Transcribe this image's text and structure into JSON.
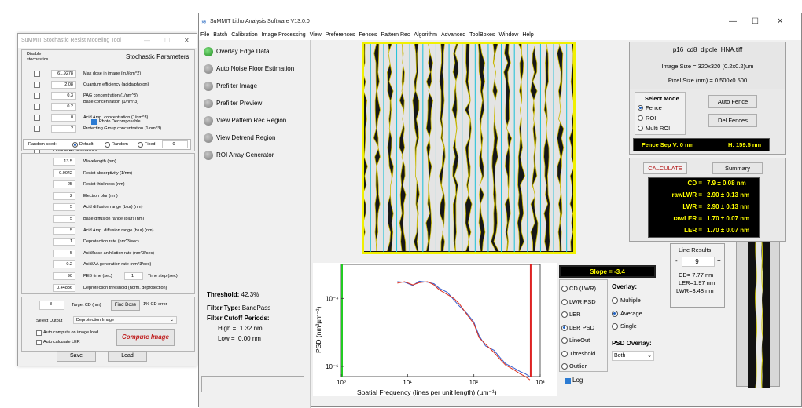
{
  "stoch": {
    "title": "SuMMIT Stochastic Resist Modeling Tool",
    "disable_label": "Disable\nstochastics",
    "params_title": "Stochastic Parameters",
    "stoch_rows": [
      {
        "value": "61.9278",
        "label": "Max dose in image (mJ/cm^2)"
      },
      {
        "value": "2.08",
        "label": "Quantum efficiency (acids/photon)"
      },
      {
        "value": "0.3",
        "label": "PAG concentration (1/nm^3)"
      },
      {
        "value": "0.2",
        "label": "Base concentration (1/nm^3)"
      },
      {
        "value": "0",
        "label": "Acid Amp. concentration (1/nm^3)"
      },
      {
        "value": "2",
        "label": "Protecting Group concentration (1/nm^3)"
      }
    ],
    "photo_decomposable": "Photo Decomposable",
    "disable_all": "Disable All Stochastics",
    "random_seed_label": "Random seed:",
    "seed_options": [
      "Default",
      "Random",
      "Fixed"
    ],
    "seed_value": "0",
    "params": [
      {
        "value": "13.5",
        "label": "Wavelength (nm)"
      },
      {
        "value": "0.0042",
        "label": "Resist absorptivity (1/nm)"
      },
      {
        "value": "25",
        "label": "Resist thickness (nm)"
      },
      {
        "value": "2",
        "label": "Electron blur (nm)"
      },
      {
        "value": "5",
        "label": "Acid diffusion range (blur) (nm)"
      },
      {
        "value": "5",
        "label": "Base diffusion range (blur) (nm)"
      },
      {
        "value": "5",
        "label": "Acid Amp. diffusion range (blur) (nm)"
      },
      {
        "value": "1",
        "label": "Deprotection rate (nm^3/sec)"
      },
      {
        "value": "5",
        "label": "Acid/base anihilation rate (nm^3/sec)"
      },
      {
        "value": "0.2",
        "label": "Acid/AA generation rate (nm^3/sec)"
      }
    ],
    "peb_value": "90",
    "peb_label": "PEB time (sec)",
    "timestep_value": "1",
    "timestep_label": "Time step (sec)",
    "threshold_value": "0.44836",
    "threshold_label": "Deprotection threshold (norm. deprotection)",
    "target_cd_value": "8",
    "target_cd_label": "Target CD (nm)",
    "find_dose": "Find Dose",
    "cd_error": "1% CD error",
    "select_output_label": "Select Output",
    "select_output_value": "Deprotection Image",
    "auto_compute": "Auto compute on image load",
    "auto_ler": "Auto calculate LER",
    "compute_image": "Compute Image",
    "save": "Save",
    "load": "Load"
  },
  "main": {
    "title": "SuMMIT Litho Analysis Software V13.0.0",
    "menu": [
      "File",
      "Batch",
      "Calibration",
      "Image Processing",
      "View",
      "Preferences",
      "Fences",
      "Pattern Rec",
      "Algorithm",
      "Advanced",
      "ToolBoxes",
      "Window",
      "Help"
    ],
    "commands": [
      "Overlay Edge Data",
      "Auto Noise Floor Estimation",
      "Prefilter Image",
      "Prefilter Preview",
      "View Pattern Rec Region",
      "View Detrend Region",
      "ROI Array Generator"
    ],
    "threshold_label": "Threshold:",
    "threshold_value": "42.3%",
    "filter_type_label": "Filter Type:",
    "filter_type_value": "BandPass",
    "cutoff_label": "Filter Cutoff Periods:",
    "high_label": "High =",
    "high_value": "1.32 nm",
    "low_label": "Low =",
    "low_value": "0.00 nm",
    "file_name": "p16_cd8_dipole_HNA.tiff",
    "image_size": "Image Size = 320x320 (0.2x0.2)um",
    "pixel_size": "Pixel Size (nm) = 0.500x0.500",
    "select_mode_title": "Select Mode",
    "modes": [
      "Fence",
      "ROI",
      "Multi ROI"
    ],
    "auto_fence": "Auto Fence",
    "del_fences": "Del Fences",
    "fence_sep": "Fence Sep  V:  0 nm",
    "fence_h": "H:  159.5 nm",
    "calculate": "CALCULATE",
    "summary": "Summary",
    "results": [
      {
        "label": "CD =",
        "value": "7.9 ± 0.08 nm"
      },
      {
        "label": "rawLWR =",
        "value": "2.90 ± 0.13 nm"
      },
      {
        "label": "LWR =",
        "value": "2.90 ± 0.13 nm"
      },
      {
        "label": "rawLER =",
        "value": "1.70 ± 0.07 nm"
      },
      {
        "label": "LER =",
        "value": "1.70 ± 0.07 nm"
      }
    ],
    "line_results_title": "Line Results",
    "line_minus": "-",
    "line_plus": "+",
    "line_index": "9",
    "line_cd": "CD= 7.77 nm",
    "line_ler": "LER=1.97 nm",
    "line_lwr": "LWR=3.48 nm",
    "slope": "Slope = -3.4",
    "psd_options": [
      "CD (LWR)",
      "LWR PSD",
      "LER",
      "LER PSD",
      "LineOut",
      "Threshold",
      "Outlier"
    ],
    "psd_selected": 3,
    "overlay_title": "Overlay:",
    "overlay_options": [
      "Multiple",
      "Average",
      "Single"
    ],
    "overlay_selected": 1,
    "psd_overlay_title": "PSD Overlay:",
    "psd_overlay_value": "Both",
    "log_label": "Log"
  },
  "chart_data": {
    "type": "line",
    "title": "",
    "xlabel": "Spatial Frequency (lines per unit length) (µm⁻¹)",
    "ylabel": "PSD (nm²µm⁻¹)",
    "xscale": "log",
    "yscale": "log",
    "xlim": [
      1,
      1000
    ],
    "ylim": [
      5e-07,
      0.001
    ],
    "x_ticks": [
      "10⁰",
      "10¹",
      "10²",
      "10³"
    ],
    "y_ticks": [
      "10⁻⁴",
      "10⁻⁶"
    ],
    "vlines": [
      {
        "x": 1.0,
        "color": "#22cc22"
      },
      {
        "x": 700,
        "color": "#dd2222"
      }
    ],
    "series": [
      {
        "color": "#3a5fcd",
        "x": [
          7,
          9,
          12,
          15,
          20,
          25,
          30,
          40,
          50,
          60,
          80,
          100,
          120,
          150,
          200,
          250,
          300,
          400,
          500,
          600,
          700
        ],
        "y": [
          0.00031,
          0.0003,
          0.00024,
          0.00032,
          0.0003,
          0.00027,
          0.0002,
          0.00015,
          9e-05,
          6e-05,
          3.5e-05,
          2e-05,
          8e-06,
          4e-06,
          3e-06,
          1.8e-06,
          1.2e-06,
          9e-07,
          7e-07,
          6e-07,
          5e-07
        ]
      },
      {
        "color": "#dd3322",
        "x": [
          7,
          9,
          12,
          15,
          20,
          25,
          30,
          40,
          50,
          60,
          80,
          100,
          120,
          150,
          200,
          250,
          300,
          400,
          500,
          600,
          700
        ],
        "y": [
          0.00028,
          0.00031,
          0.00025,
          0.00029,
          0.00031,
          0.00025,
          0.00018,
          0.00013,
          0.0001,
          7e-05,
          3.2e-05,
          1.8e-05,
          7e-06,
          4.5e-06,
          2.6e-06,
          1.6e-06,
          1.1e-06,
          8e-07,
          6e-07,
          5e-07,
          4e-07
        ]
      }
    ]
  }
}
